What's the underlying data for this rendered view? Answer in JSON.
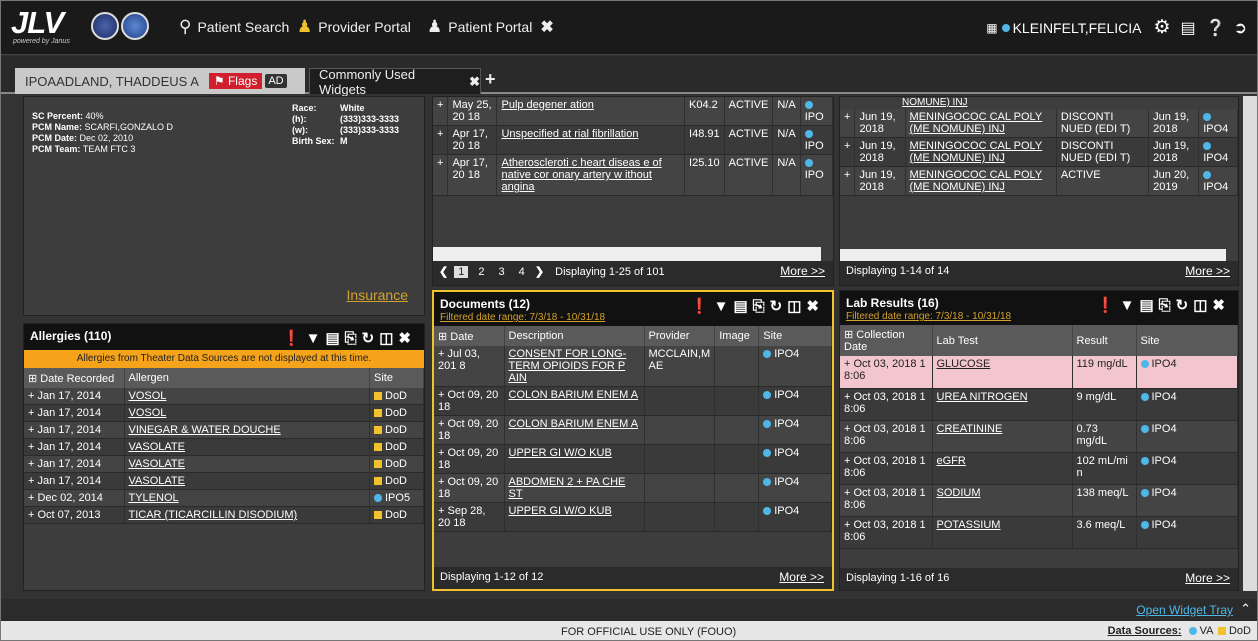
{
  "app": {
    "logo": "JLV",
    "powered": "powered by Janus"
  },
  "nav": {
    "patient_search": "Patient Search",
    "provider_portal": "Provider Portal",
    "patient_portal": "Patient Portal"
  },
  "user": {
    "name": "KLEINFELT,FELICIA"
  },
  "tabs": {
    "patient": "IPOAADLAND, THADDEUS A",
    "flags": "Flags",
    "ad": "AD",
    "widgets": "Commonly Used Widgets"
  },
  "demo": {
    "sc_label": "SC Percent:",
    "sc": "40%",
    "pcm_label": "PCM Name:",
    "pcm": "SCARFI,GONZALO D",
    "pcmd_label": "PCM Date:",
    "pcmd": "Dec 02, 2010",
    "pcmt_label": "PCM Team:",
    "pcmt": "TEAM FTC 3",
    "race_label": "Race:",
    "race": "White",
    "h_label": "(h):",
    "h": "(333)333-3333",
    "w_label": "(w):",
    "w": "(333)333-3333",
    "sex_label": "Birth Sex:",
    "sex": "M",
    "insurance": "Insurance"
  },
  "allergies": {
    "title": "Allergies (110)",
    "banner": "Allergies from Theater Data Sources are not displayed at this time.",
    "cols": [
      "Date Recorded",
      "Allergen",
      "Site"
    ],
    "rows": [
      [
        "Jan 17, 2014",
        "VOSOL",
        "DoD"
      ],
      [
        "Jan 17, 2014",
        "VOSOL",
        "DoD"
      ],
      [
        "Jan 17, 2014",
        "VINEGAR & WATER DOUCHE",
        "DoD"
      ],
      [
        "Jan 17, 2014",
        "VASOLATE",
        "DoD"
      ],
      [
        "Jan 17, 2014",
        "VASOLATE",
        "DoD"
      ],
      [
        "Jan 17, 2014",
        "VASOLATE",
        "DoD"
      ],
      [
        "Dec 02, 2014",
        "TYLENOL",
        "IPO5"
      ],
      [
        "Oct 07, 2013",
        "TICAR (TICARCILLIN DISODIUM)",
        "DoD"
      ]
    ]
  },
  "problems": {
    "rows": [
      [
        "May 25, 20 18",
        "Pulp degener ation",
        "K04.2",
        "ACTIVE",
        "N/A",
        "IPO"
      ],
      [
        "Apr 17, 20 18",
        "Unspecified at rial fibrillation",
        "I48.91",
        "ACTIVE",
        "N/A",
        "IPO"
      ],
      [
        "Apr 17, 20 18",
        "Atheroscleroti c heart diseas e of native cor onary artery w ithout angina",
        "I25.10",
        "ACTIVE",
        "N/A",
        "IPO"
      ]
    ],
    "pages": [
      "1",
      "2",
      "3",
      "4"
    ],
    "display": "Displaying 1-25 of 101",
    "more": "More >>"
  },
  "immun": {
    "rows": [
      [
        "Jun 19, 2018",
        "MENINGOCOC CAL POLY (ME NOMUNE) INJ",
        "DISCONTI NUED (EDI T)",
        "Jun 19, 2018",
        "IPO4"
      ],
      [
        "Jun 19, 2018",
        "MENINGOCOC CAL POLY (ME NOMUNE) INJ",
        "DISCONTI NUED (EDI T)",
        "Jun 19, 2018",
        "IPO4"
      ],
      [
        "Jun 19, 2018",
        "MENINGOCOC CAL POLY (ME NOMUNE) INJ",
        "ACTIVE",
        "Jun 20, 2019",
        "IPO4"
      ]
    ],
    "display": "Displaying 1-14 of 14",
    "more": "More >>",
    "top": "NOMUNE) INJ"
  },
  "documents": {
    "title": "Documents (12)",
    "filter": "Filtered date range: 7/3/18 - 10/31/18",
    "cols": [
      "Date",
      "Description",
      "Provider",
      "Image",
      "Site"
    ],
    "rows": [
      [
        "Jul 03, 201 8",
        "CONSENT FOR LONG-TERM OPIOIDS FOR P AIN",
        "MCCLAIN,M AE",
        "",
        "IPO4"
      ],
      [
        "Oct 09, 20 18",
        "COLON BARIUM ENEM A",
        "",
        "",
        "IPO4"
      ],
      [
        "Oct 09, 20 18",
        "COLON BARIUM ENEM A",
        "",
        "",
        "IPO4"
      ],
      [
        "Oct 09, 20 18",
        "UPPER GI W/O KUB",
        "",
        "",
        "IPO4"
      ],
      [
        "Oct 09, 20 18",
        "ABDOMEN 2 + PA CHE ST",
        "",
        "",
        "IPO4"
      ],
      [
        "Sep 28, 20 18",
        "UPPER GI W/O KUB",
        "",
        "",
        "IPO4"
      ]
    ],
    "display": "Displaying 1-12 of 12",
    "more": "More >>"
  },
  "labs": {
    "title": "Lab Results (16)",
    "filter": "Filtered date range: 7/3/18 - 10/31/18",
    "cols": [
      "Collection Date",
      "Lab Test",
      "Result",
      "Site"
    ],
    "rows": [
      [
        "Oct 03, 2018 1 8:06",
        "GLUCOSE",
        "119 mg/dL",
        "IPO4"
      ],
      [
        "Oct 03, 2018 1 8:06",
        "UREA NITROGEN",
        "9 mg/dL",
        "IPO4"
      ],
      [
        "Oct 03, 2018 1 8:06",
        "CREATININE",
        "0.73 mg/dL",
        "IPO4"
      ],
      [
        "Oct 03, 2018 1 8:06",
        "eGFR",
        "102 mL/mi n",
        "IPO4"
      ],
      [
        "Oct 03, 2018 1 8:06",
        "SODIUM",
        "138 meq/L",
        "IPO4"
      ],
      [
        "Oct 03, 2018 1 8:06",
        "POTASSIUM",
        "3.6 meq/L",
        "IPO4"
      ]
    ],
    "display": "Displaying 1-16 of 16",
    "more": "More >>"
  },
  "footer": {
    "tray": "Open Widget Tray",
    "fouo": "FOR OFFICIAL USE ONLY (FOUO)",
    "sources": "Data Sources:",
    "va": "VA",
    "dod": "DoD"
  }
}
